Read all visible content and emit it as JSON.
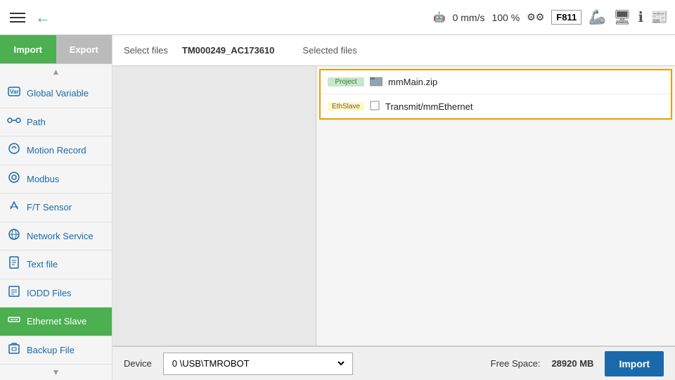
{
  "topbar": {
    "speed": "0 mm/s",
    "percent": "100 %",
    "frame": "F811"
  },
  "tabs": {
    "import_label": "Import",
    "export_label": "Export"
  },
  "sidebar": {
    "items": [
      {
        "id": "global-variable",
        "label": "Global Variable",
        "icon": "📦"
      },
      {
        "id": "path",
        "label": "Path",
        "icon": "🛤"
      },
      {
        "id": "motion-record",
        "label": "Motion Record",
        "icon": "🔵"
      },
      {
        "id": "modbus",
        "label": "Modbus",
        "icon": "⚙"
      },
      {
        "id": "ft-sensor",
        "label": "F/T Sensor",
        "icon": "🔧"
      },
      {
        "id": "network-service",
        "label": "Network Service",
        "icon": "🌐"
      },
      {
        "id": "text-file",
        "label": "Text file",
        "icon": "📄"
      },
      {
        "id": "iodd-files",
        "label": "IODD Files",
        "icon": "📋"
      },
      {
        "id": "ethernet-slave",
        "label": "Ethernet Slave",
        "icon": "🔗",
        "active": true
      },
      {
        "id": "backup-file",
        "label": "Backup File",
        "icon": "💾"
      }
    ]
  },
  "file_header": {
    "select_files_label": "Select files",
    "file_id": "TM000249_AC173610",
    "selected_files_label": "Selected files"
  },
  "selected_files": [
    {
      "tag": "Project",
      "tag_type": "project",
      "icon": "🗂",
      "name": "mmMain.zip"
    },
    {
      "tag": "EthSlave",
      "tag_type": "ethslave",
      "icon": "☐",
      "name": "Transmit/mmEthernet"
    }
  ],
  "bottom": {
    "device_label": "Device",
    "device_value": "0     \\USB\\TMROBOT",
    "free_space_label": "Free Space:",
    "free_space_value": "28920 MB",
    "import_btn_label": "Import"
  }
}
